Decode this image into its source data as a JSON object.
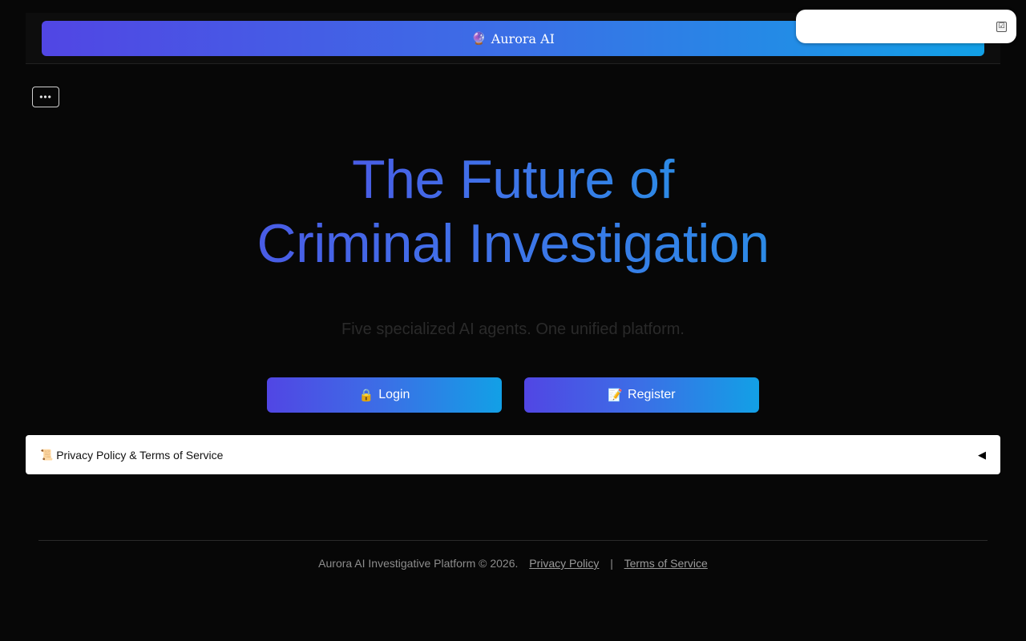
{
  "header": {
    "brand_icon": "🔮",
    "brand_name": "Aurora AI"
  },
  "toolbar": {
    "icon": "calendar-check-icon",
    "icon_glyph": "☑"
  },
  "menu": {
    "label": "•••"
  },
  "hero": {
    "title_line1": "The Future of",
    "title_line2": "Criminal Investigation",
    "subtitle": "Five specialized AI agents. One unified platform."
  },
  "actions": {
    "login_icon": "🔒",
    "login_label": "Login",
    "register_icon": "📝",
    "register_label": "Register"
  },
  "policy": {
    "icon": "📜",
    "label": "Privacy Policy & Terms of Service",
    "toggle": "◀"
  },
  "footer": {
    "copyright": "Aurora AI Investigative Platform © 2026.",
    "privacy_link": "Privacy Policy",
    "separator": "|",
    "terms_link": "Terms of Service"
  },
  "colors": {
    "background": "#070707",
    "gradient_start": "#5146e4",
    "gradient_end": "#12a0e6",
    "hero_text": "#3f72e8"
  }
}
